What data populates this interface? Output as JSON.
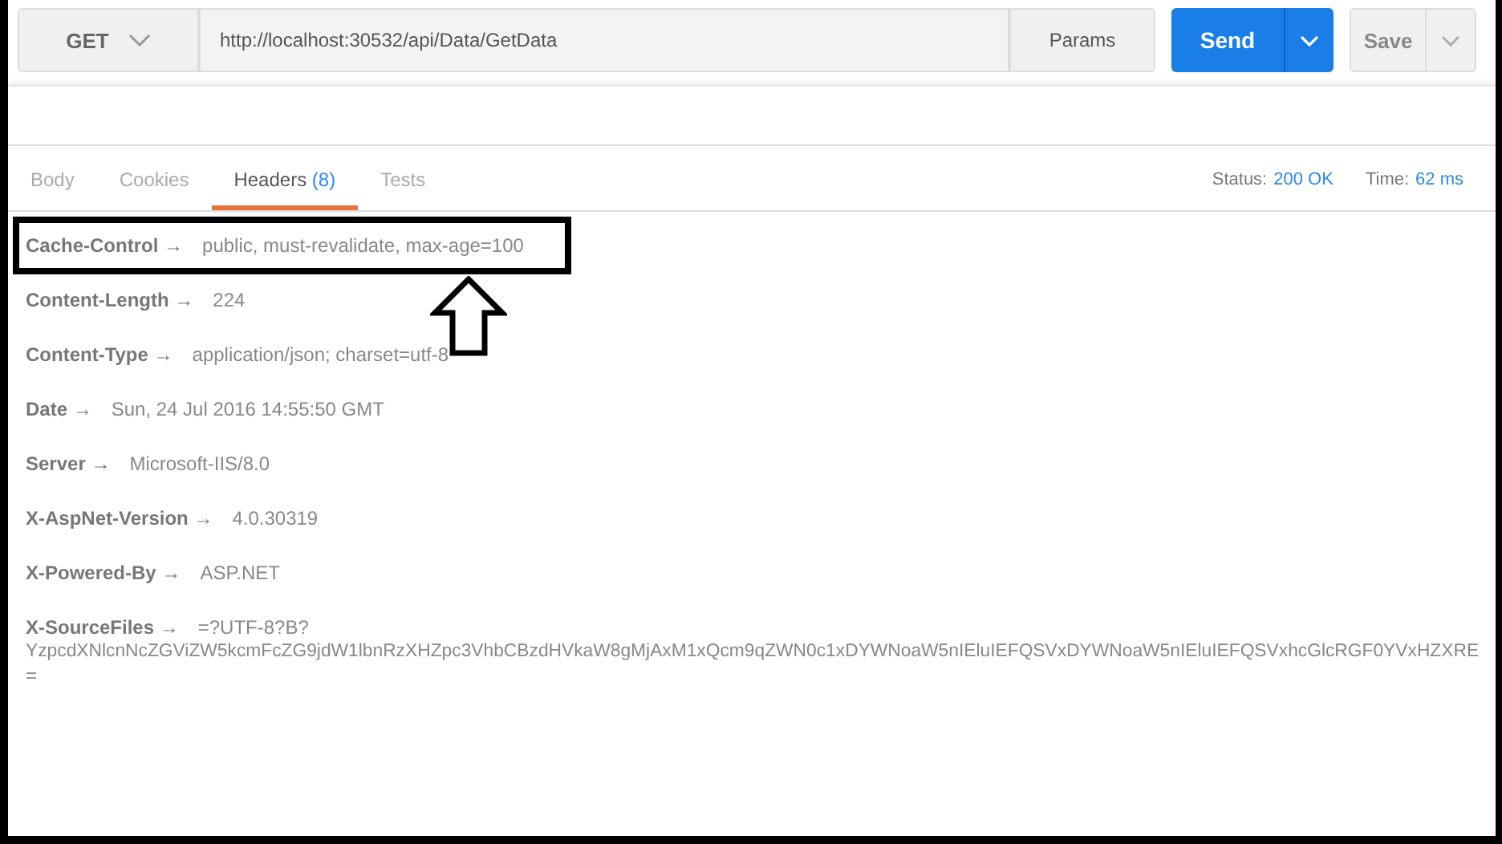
{
  "request": {
    "method": "GET",
    "url": "http://localhost:30532/api/Data/GetData",
    "params_label": "Params",
    "send_label": "Send",
    "save_label": "Save"
  },
  "tabs": [
    {
      "label": "Body",
      "selected": false
    },
    {
      "label": "Cookies",
      "selected": false
    },
    {
      "label": "Headers",
      "count": "(8)",
      "selected": true
    },
    {
      "label": "Tests",
      "selected": false
    }
  ],
  "status": {
    "status_label": "Status:",
    "status_value": "200 OK",
    "time_label": "Time:",
    "time_value": "62 ms"
  },
  "headers": [
    {
      "name": "Cache-Control",
      "arrow": "→",
      "value_lines": [
        "public, must-revalidate, max-age=100"
      ],
      "highlighted": true
    },
    {
      "name": "Content-Length",
      "arrow": "→",
      "value_lines": [
        "224"
      ],
      "highlighted": false
    },
    {
      "name": "Content-Type",
      "arrow": "→",
      "value_lines": [
        "application/json; charset=utf-8"
      ],
      "highlighted": false
    },
    {
      "name": "Date",
      "arrow": "→",
      "value_lines": [
        "Sun, 24 Jul 2016 14:55:50 GMT"
      ],
      "highlighted": false
    },
    {
      "name": "Server",
      "arrow": "→",
      "value_lines": [
        "Microsoft-IIS/8.0"
      ],
      "highlighted": false
    },
    {
      "name": "X-AspNet-Version",
      "arrow": "→",
      "value_lines": [
        "4.0.30319"
      ],
      "highlighted": false
    },
    {
      "name": "X-Powered-By",
      "arrow": "→",
      "value_lines": [
        "ASP.NET"
      ],
      "highlighted": false
    },
    {
      "name": "X-SourceFiles",
      "arrow": "→",
      "value_lines": [
        "=?UTF-8?B?",
        "YzpcdXNlcnNcZGViZW5kcmFcZG9jdW1lbnRzXHZpc3VhbCBzdHVkaW8gMjAxM1xQcm9qZWN0c1xDYWNoaW5nIEluIEFQSVxDYWNoaW5nIEluIEFQSVxhcGlcRGF0YVxHZXRE",
        "="
      ],
      "highlighted": false
    }
  ]
}
